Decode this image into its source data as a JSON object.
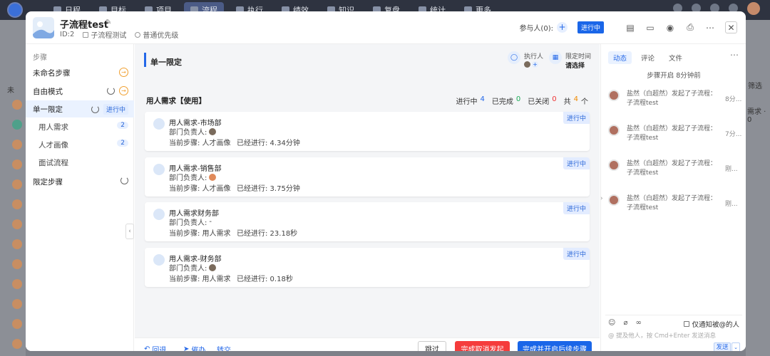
{
  "app": {
    "nav": [
      "日程",
      "目标",
      "项目",
      "流程",
      "执行",
      "绩效",
      "知识",
      "复盘",
      "统计",
      "更多"
    ],
    "active_nav": "流程"
  },
  "background": {
    "left_labels": [
      "未"
    ],
    "right_labels": [
      "筛选",
      "需求 · 0"
    ]
  },
  "modal": {
    "title": "子流程test",
    "id_label": "ID:2",
    "category": "子流程测试",
    "priority": "普通优先级",
    "participants_label": "参与人(0):",
    "status": "进行中"
  },
  "steps": {
    "title": "步骤",
    "items": [
      {
        "label": "未命名步骤",
        "badge": "",
        "count": ""
      },
      {
        "label": "自由模式",
        "badge": "",
        "count": ""
      },
      {
        "label": "单一限定",
        "badge": "进行中",
        "count": ""
      },
      {
        "label": "用人需求",
        "badge": "",
        "count": "2"
      },
      {
        "label": "人才画像",
        "badge": "",
        "count": "2"
      },
      {
        "label": "面试流程",
        "badge": "",
        "count": ""
      },
      {
        "label": "限定步骤",
        "badge": "",
        "count": ""
      }
    ]
  },
  "center": {
    "stage_name": "单一限定",
    "executor_label": "执行人",
    "deadline_label": "限定时间",
    "deadline_value": "请选择",
    "sub_title": "用人需求【使用】",
    "stats": {
      "in_progress_label": "进行中",
      "in_progress": "4",
      "done_label": "已完成",
      "done": "0",
      "closed_label": "已关闭",
      "closed": "0",
      "total_prefix": "共",
      "total": "4",
      "total_suffix": "个"
    },
    "cards": [
      {
        "name": "用人需求-市场部",
        "owner": "部门负责人:",
        "owner_value": "",
        "step": "当前步骤: 人才画像",
        "time": "已经进行: 4.34分钟",
        "status": "进行中"
      },
      {
        "name": "用人需求-销售部",
        "owner": "部门负责人:",
        "owner_value": "",
        "step": "当前步骤: 人才画像",
        "time": "已经进行: 3.75分钟",
        "status": "进行中"
      },
      {
        "name": "用人需求财务部",
        "owner": "部门负责人:",
        "owner_value": "-",
        "step": "当前步骤: 用人需求",
        "time": "已经进行: 23.18秒",
        "status": "进行中"
      },
      {
        "name": "用人需求-财务部",
        "owner": "部门负责人:",
        "owner_value": "",
        "step": "当前步骤: 用人需求",
        "time": "已经进行: 0.18秒",
        "status": "进行中"
      }
    ],
    "footer": {
      "rollback": "回退",
      "urge": "催办",
      "transfer": "转交",
      "skip": "跳过",
      "cancel": "完成取消发起",
      "complete": "完成并开启后续步骤"
    }
  },
  "right": {
    "tabs": [
      "动态",
      "评论",
      "文件"
    ],
    "top_line": "步骤开启 8分钟前",
    "activities": [
      {
        "text": "盐然（白超然）发起了子流程：子流程test",
        "time": "8分..."
      },
      {
        "text": "盐然（白超然）发起了子流程：子流程test",
        "time": "7分..."
      },
      {
        "text": "盐然（白超然）发起了子流程：子流程test",
        "time": "刚..."
      },
      {
        "text": "盐然（白超然）发起了子流程：子流程test",
        "time": "刚..."
      }
    ],
    "notify_label": "仅通知被@的人",
    "input_placeholder": "@ 提及他人，按 Cmd+Enter 发送消息",
    "send_label": "发送"
  }
}
